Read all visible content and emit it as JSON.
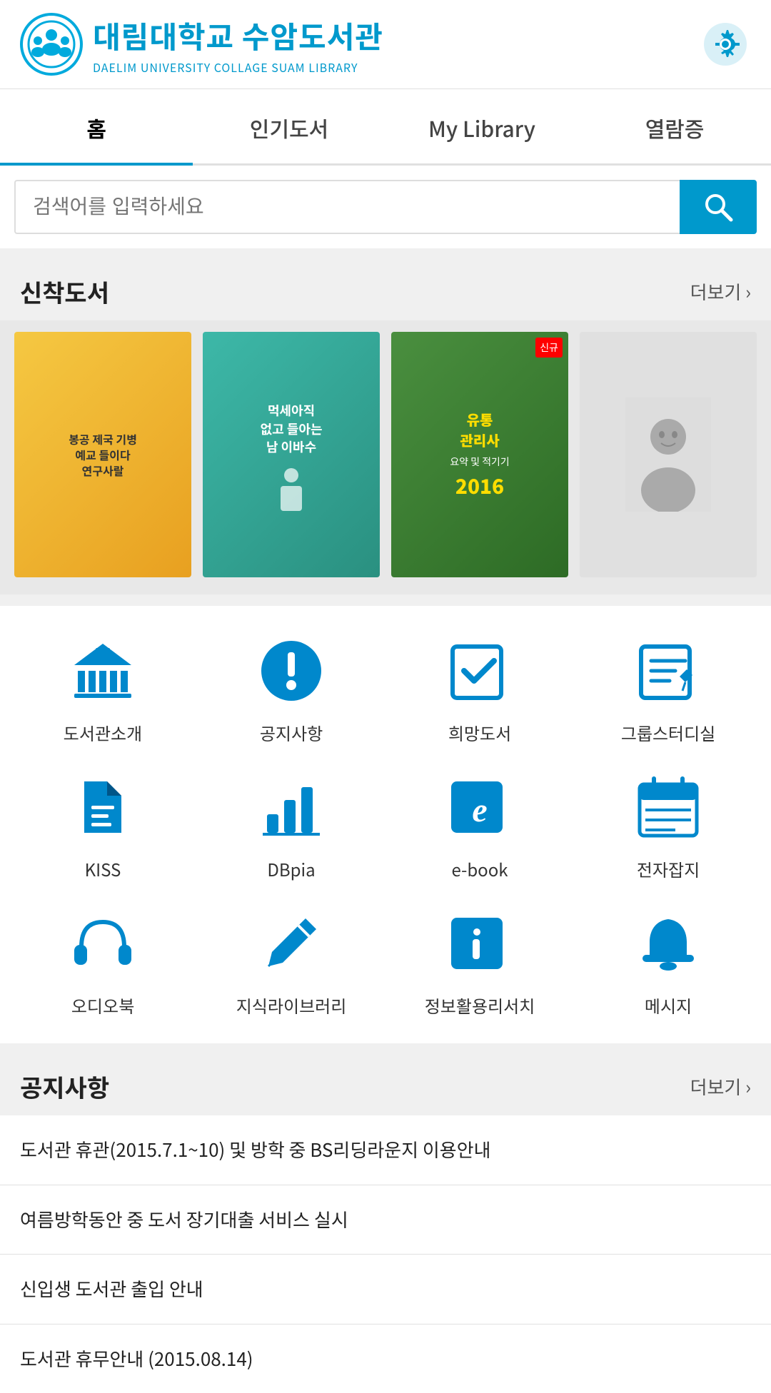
{
  "header": {
    "logo_korean": "대림대학교 수암도서관",
    "logo_english": "DAELIM UNIVERSITY COLLAGE SUAM LIBRARY"
  },
  "nav": {
    "items": [
      {
        "id": "home",
        "label": "홈",
        "active": true
      },
      {
        "id": "popular",
        "label": "인기도서",
        "active": false
      },
      {
        "id": "mylibrary",
        "label": "My Library",
        "active": false
      },
      {
        "id": "checkout",
        "label": "열람증",
        "active": false
      }
    ]
  },
  "search": {
    "placeholder": "검색어를 입력하세요"
  },
  "new_books": {
    "title": "신착도서",
    "more": "더보기 ›"
  },
  "icons": [
    {
      "id": "library-intro",
      "label": "도서관소개",
      "type": "bank"
    },
    {
      "id": "notice",
      "label": "공지사항",
      "type": "exclaim"
    },
    {
      "id": "wish-book",
      "label": "희망도서",
      "type": "checkbox"
    },
    {
      "id": "group-study",
      "label": "그룹스터디실",
      "type": "edit"
    },
    {
      "id": "kiss",
      "label": "KISS",
      "type": "document"
    },
    {
      "id": "dbpia",
      "label": "DBpia",
      "type": "chart"
    },
    {
      "id": "ebook",
      "label": "e-book",
      "type": "ebook"
    },
    {
      "id": "journal",
      "label": "전자잡지",
      "type": "calendar"
    },
    {
      "id": "audiobook",
      "label": "오디오북",
      "type": "headphone"
    },
    {
      "id": "knowledge",
      "label": "지식라이브러리",
      "type": "pen"
    },
    {
      "id": "info",
      "label": "정보활용리서치",
      "type": "info"
    },
    {
      "id": "message",
      "label": "메시지",
      "type": "bell"
    }
  ],
  "announcements": {
    "title": "공지사항",
    "more": "더보기 ›",
    "items": [
      {
        "text": "도서관 휴관(2015.7.1~10) 및 방학 중 BS리딩라운지 이용안내"
      },
      {
        "text": "여름방학동안 중 도서 장기대출 서비스 실시"
      },
      {
        "text": "신입생 도서관 출입 안내"
      },
      {
        "text": "도서관 휴무안내 (2015.08.14)"
      }
    ]
  }
}
